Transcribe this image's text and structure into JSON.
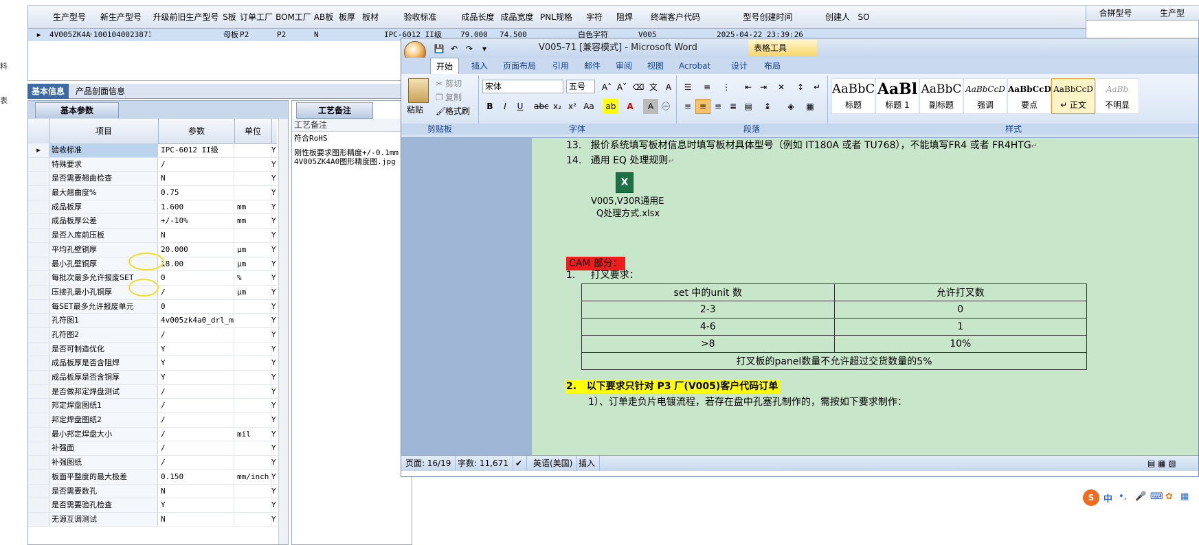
{
  "left_nav": {
    "items": [
      "料",
      "表"
    ]
  },
  "main_grid": {
    "columns": [
      "生产型号",
      "新生产型号",
      "升级前旧生产型号",
      "S板",
      "订单工厂",
      "BOM工厂",
      "AB板",
      "板厚",
      "板材",
      "验收标准",
      "成品长度",
      "成品宽度",
      "PNL规格",
      "字符",
      "阻焊",
      "终端客户代码",
      "型号创建时间",
      "创建人",
      "SO"
    ],
    "row": [
      "4V005ZK4A0",
      "10010400238716",
      "",
      "母板",
      "P2",
      "P2",
      "N",
      "",
      "",
      "IPC-6012 II级",
      "79.000",
      "74.500",
      "",
      "白色字符",
      "",
      "V005",
      "2025-04-22 23:39:26",
      "",
      ""
    ]
  },
  "right_grid": {
    "columns": [
      "合拼型号",
      "生产型"
    ]
  },
  "tabs": {
    "basic_info": "基本信息",
    "profile_info": "产品剖面信息"
  },
  "prop_panel": {
    "tab_label": "基本参数",
    "col_item": "项目",
    "col_param": "参数",
    "col_unit": "单位",
    "rows": [
      {
        "item": "验收标准",
        "value": "IPC-6012 II级",
        "unit": "",
        "flag": "Y"
      },
      {
        "item": "特殊要求",
        "value": "/",
        "unit": "",
        "flag": "Y"
      },
      {
        "item": "是否需要翘曲检查",
        "value": "N",
        "unit": "",
        "flag": "Y"
      },
      {
        "item": "最大翘曲度%",
        "value": "0.75",
        "unit": "",
        "flag": "Y"
      },
      {
        "item": "成品板厚",
        "value": "1.600",
        "unit": "mm",
        "flag": "Y"
      },
      {
        "item": "成品板厚公差",
        "value": "+/-10%",
        "unit": "mm",
        "flag": "Y"
      },
      {
        "item": "是否入库前压板",
        "value": "N",
        "unit": "",
        "flag": "Y"
      },
      {
        "item": "平均孔壁铜厚",
        "value": "20.000",
        "unit": "μm",
        "flag": "Y"
      },
      {
        "item": "最小孔壁铜厚",
        "value": "18.00",
        "unit": "μm",
        "flag": "Y"
      },
      {
        "item": "每批次最多允许报废SET",
        "value": "0",
        "unit": "%",
        "flag": "Y"
      },
      {
        "item": "压接孔最小孔铜厚",
        "value": "/",
        "unit": "μm",
        "flag": "Y"
      },
      {
        "item": "每SET最多允许报废单元",
        "value": "0",
        "unit": "",
        "flag": "Y"
      },
      {
        "item": "孔符图1",
        "value": "4v005zk4a0_drl_m...",
        "unit": "",
        "flag": "Y"
      },
      {
        "item": "孔符图2",
        "value": "/",
        "unit": "",
        "flag": "Y"
      },
      {
        "item": "是否可制造优化",
        "value": "Y",
        "unit": "",
        "flag": "Y"
      },
      {
        "item": "成品板厚是否含阻焊",
        "value": "Y",
        "unit": "",
        "flag": "Y"
      },
      {
        "item": "成品板厚是否含铜厚",
        "value": "Y",
        "unit": "",
        "flag": "Y"
      },
      {
        "item": "是否做邦定焊盘测试",
        "value": "/",
        "unit": "",
        "flag": "Y"
      },
      {
        "item": "邦定焊盘图纸1",
        "value": "/",
        "unit": "",
        "flag": "Y"
      },
      {
        "item": "邦定焊盘图纸2",
        "value": "/",
        "unit": "",
        "flag": "Y"
      },
      {
        "item": "最小邦定焊盘大小",
        "value": "/",
        "unit": "mil",
        "flag": "Y"
      },
      {
        "item": "补强面",
        "value": "/",
        "unit": "",
        "flag": "Y"
      },
      {
        "item": "补强图纸",
        "value": "/",
        "unit": "",
        "flag": "Y"
      },
      {
        "item": "板面平整度的最大极差",
        "value": "0.150",
        "unit": "mm/inch",
        "flag": "Y"
      },
      {
        "item": "是否需要数孔",
        "value": "N",
        "unit": "",
        "flag": "Y"
      },
      {
        "item": "是否需要验孔检查",
        "value": "Y",
        "unit": "",
        "flag": "Y"
      },
      {
        "item": "无源互调测试",
        "value": "N",
        "unit": "",
        "flag": "Y"
      }
    ]
  },
  "remark_panel": {
    "tab_label": "工艺备注",
    "header": "工艺备注",
    "lines": [
      "符合RoHS",
      "",
      "刚性板要求图形精度+/-0.1mm",
      "4V005ZK4A0图形精度图.jpg"
    ]
  },
  "word": {
    "title": "V005-71 [兼容模式] - Microsoft Word",
    "context_tool": "表格工具",
    "tabs": [
      "开始",
      "插入",
      "页面布局",
      "引用",
      "邮件",
      "审阅",
      "视图",
      "Acrobat",
      "设计",
      "布局"
    ],
    "clipboard": {
      "paste": "粘贴",
      "cut": "剪切",
      "copy": "复制",
      "format_painter": "格式刷",
      "group": "剪贴板"
    },
    "font": {
      "name": "宋体",
      "size": "五号",
      "group": "字体"
    },
    "paragraph_group": "段落",
    "styles": {
      "group": "样式",
      "items": [
        {
          "preview": "AaBbC",
          "name": "标题"
        },
        {
          "preview": "AaBl",
          "name": "标题 1"
        },
        {
          "preview": "AaBbC",
          "name": "副标题"
        },
        {
          "preview": "AaBbCcD",
          "name": "强调"
        },
        {
          "preview": "AaBbCcD",
          "name": "要点"
        },
        {
          "preview": "AaBbCcD",
          "name": "↵ 正文"
        },
        {
          "preview": "AaBb",
          "name": "不明显"
        }
      ]
    },
    "doc": {
      "line13_num": "13.",
      "line13": "报价系统填写板材信息时填写板材具体型号（例如 IT180A 或者 TU768），不能填写FR4 或者 FR4HTG",
      "line14_num": "14.",
      "line14": "通用 EQ 处理规则",
      "attachment_line1": "V005,V30R通用E",
      "attachment_line2": "Q处理方式.xlsx",
      "cam_heading": "CAM 部分：",
      "item1_num": "1.",
      "item1": "打叉要求：",
      "table": {
        "headers": [
          "set 中的unit 数",
          "允许打叉数"
        ],
        "rows": [
          [
            "2-3",
            "0"
          ],
          [
            "4-6",
            "1"
          ],
          [
            ">8",
            "10%"
          ]
        ],
        "footer": "打叉板的panel数量不允许超过交货数量的5%"
      },
      "sec2_num": "2.",
      "sec2": "以下要求只针对 P3 厂(V005)客户代码订单",
      "sec2_line1": "1）、订单走负片电镀流程，若存在盘中孔塞孔制作的，需按如下要求制作："
    },
    "status": {
      "page": "页面: 16/19",
      "words": "字数: 11,671",
      "lang": "英语(美国)",
      "mode": "插入"
    }
  },
  "ime": {
    "label": "中"
  },
  "colors": {
    "accent": "#3b6aa5",
    "highlight_red": "#ee1c1c",
    "highlight_yellow": "#ffff00",
    "doc_bg": "#c8e6c9"
  }
}
